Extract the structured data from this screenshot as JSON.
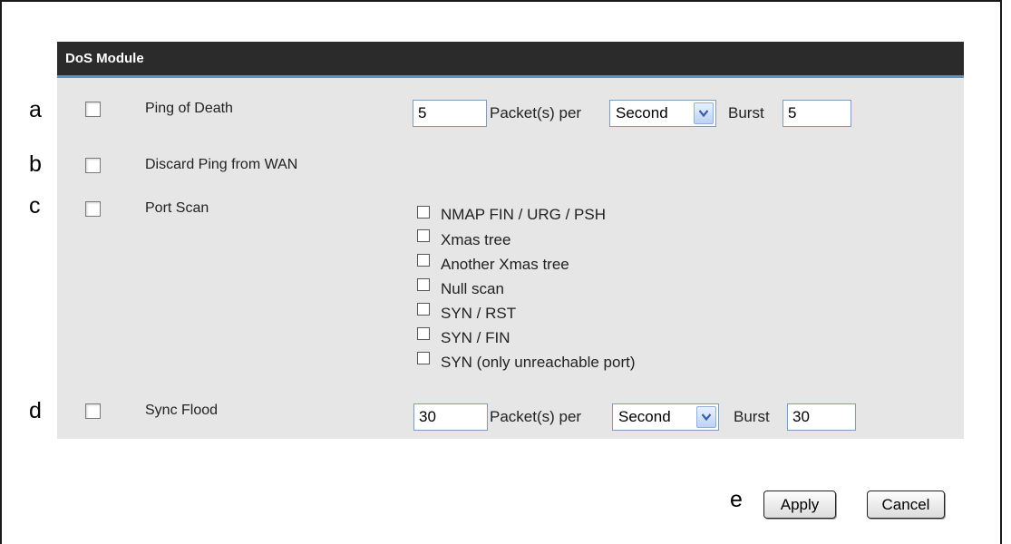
{
  "panel": {
    "title": "DoS Module"
  },
  "annotations": {
    "a": "a",
    "b": "b",
    "c": "c",
    "d": "d",
    "e": "e"
  },
  "rows": {
    "ping_of_death": {
      "label": "Ping of Death",
      "rate_value": "5",
      "unit_text": "Packet(s) per",
      "period": "Second",
      "burst_label": "Burst",
      "burst_value": "5"
    },
    "discard_ping": {
      "label": "Discard Ping from WAN"
    },
    "port_scan": {
      "label": "Port Scan",
      "options": [
        "NMAP FIN / URG / PSH",
        "Xmas tree",
        "Another Xmas tree",
        "Null scan",
        "SYN / RST",
        "SYN / FIN",
        "SYN (only unreachable port)"
      ]
    },
    "sync_flood": {
      "label": "Sync Flood",
      "rate_value": "30",
      "unit_text": "Packet(s) per",
      "period": "Second",
      "burst_label": "Burst",
      "burst_value": "30"
    }
  },
  "buttons": {
    "apply": "Apply",
    "cancel": "Cancel"
  }
}
